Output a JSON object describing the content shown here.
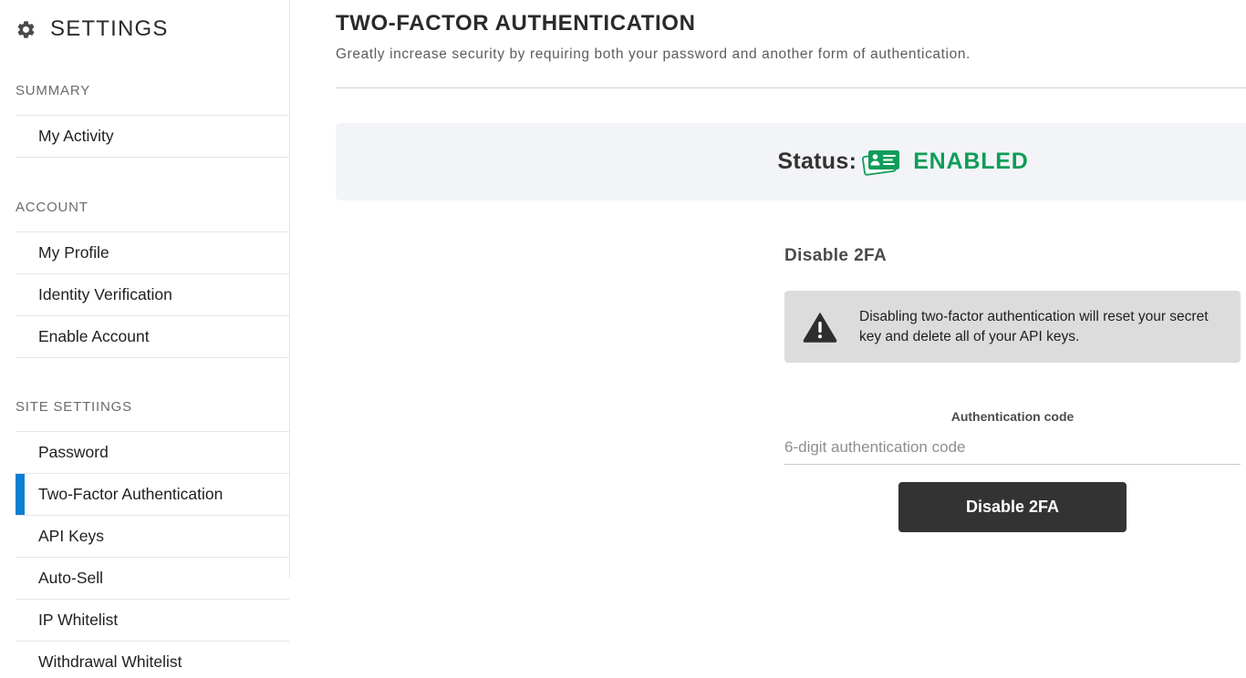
{
  "sidebar": {
    "title": "SETTINGS",
    "icon": "gear-icon",
    "sections": [
      {
        "label": "SUMMARY",
        "items": [
          {
            "label": "My Activity",
            "active": false
          }
        ]
      },
      {
        "label": "ACCOUNT",
        "items": [
          {
            "label": "My Profile",
            "active": false
          },
          {
            "label": "Identity Verification",
            "active": false
          },
          {
            "label": "Enable Account",
            "active": false
          }
        ]
      },
      {
        "label": "SITE SETTIINGS",
        "items": [
          {
            "label": "Password",
            "active": false
          },
          {
            "label": "Two-Factor Authentication",
            "active": true
          },
          {
            "label": "API Keys",
            "active": false
          },
          {
            "label": "Auto-Sell",
            "active": false
          },
          {
            "label": "IP Whitelist",
            "active": false
          },
          {
            "label": "Withdrawal Whitelist",
            "active": false
          }
        ]
      }
    ],
    "active_color": "#0a7fd0"
  },
  "main": {
    "title": "TWO-FACTOR AUTHENTICATION",
    "subtitle": "Greatly increase security by requiring both your password and another form of authentication.",
    "status": {
      "label": "Status:",
      "icon": "id-card-icon",
      "value": "ENABLED",
      "color": "#0f9d58"
    },
    "disable_section": {
      "heading": "Disable 2FA",
      "warning": {
        "icon": "warning-triangle-icon",
        "text": "Disabling two-factor authentication will reset your secret key and delete all of your API keys."
      },
      "code_field": {
        "label": "Authentication code",
        "value": "",
        "placeholder": "6-digit authentication code"
      },
      "button_label": "Disable 2FA"
    }
  }
}
